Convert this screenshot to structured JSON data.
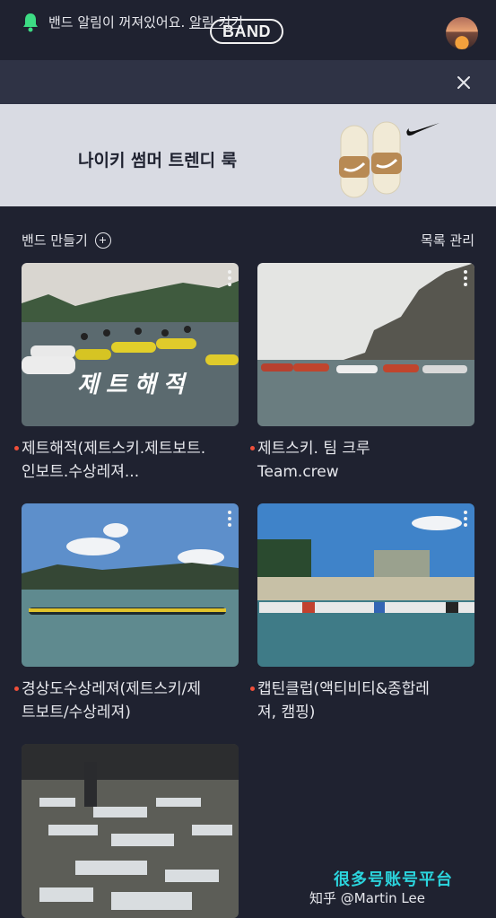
{
  "header": {
    "logo": "BAND",
    "avatar_icon": "profile-avatar"
  },
  "notification": {
    "message": "밴드 알림이 꺼져있어요.",
    "link": "알림 켜기",
    "bell_color": "#3ddc84"
  },
  "ad": {
    "title": "나이키 썸머 트렌디 룩"
  },
  "section": {
    "create": "밴드 만들기",
    "manage": "목록 관리"
  },
  "bands": [
    {
      "title": "제트해적(제트스키.제트보트.",
      "title2": "인보트.수상레져...",
      "overlay": "제트해적"
    },
    {
      "title": "제트스키. 팀 크루",
      "title2": "Team.crew"
    },
    {
      "title": "경상도수상레져(제트스키/제",
      "title2": "트보트/수상레져)"
    },
    {
      "title": "캡틴클럽(액티비티&종합레",
      "title2": "져, 캠핑)"
    }
  ],
  "watermark": {
    "line1": "很多号账号平台",
    "line2": "知乎 @Martin Lee"
  },
  "accent": "#f04f3a"
}
